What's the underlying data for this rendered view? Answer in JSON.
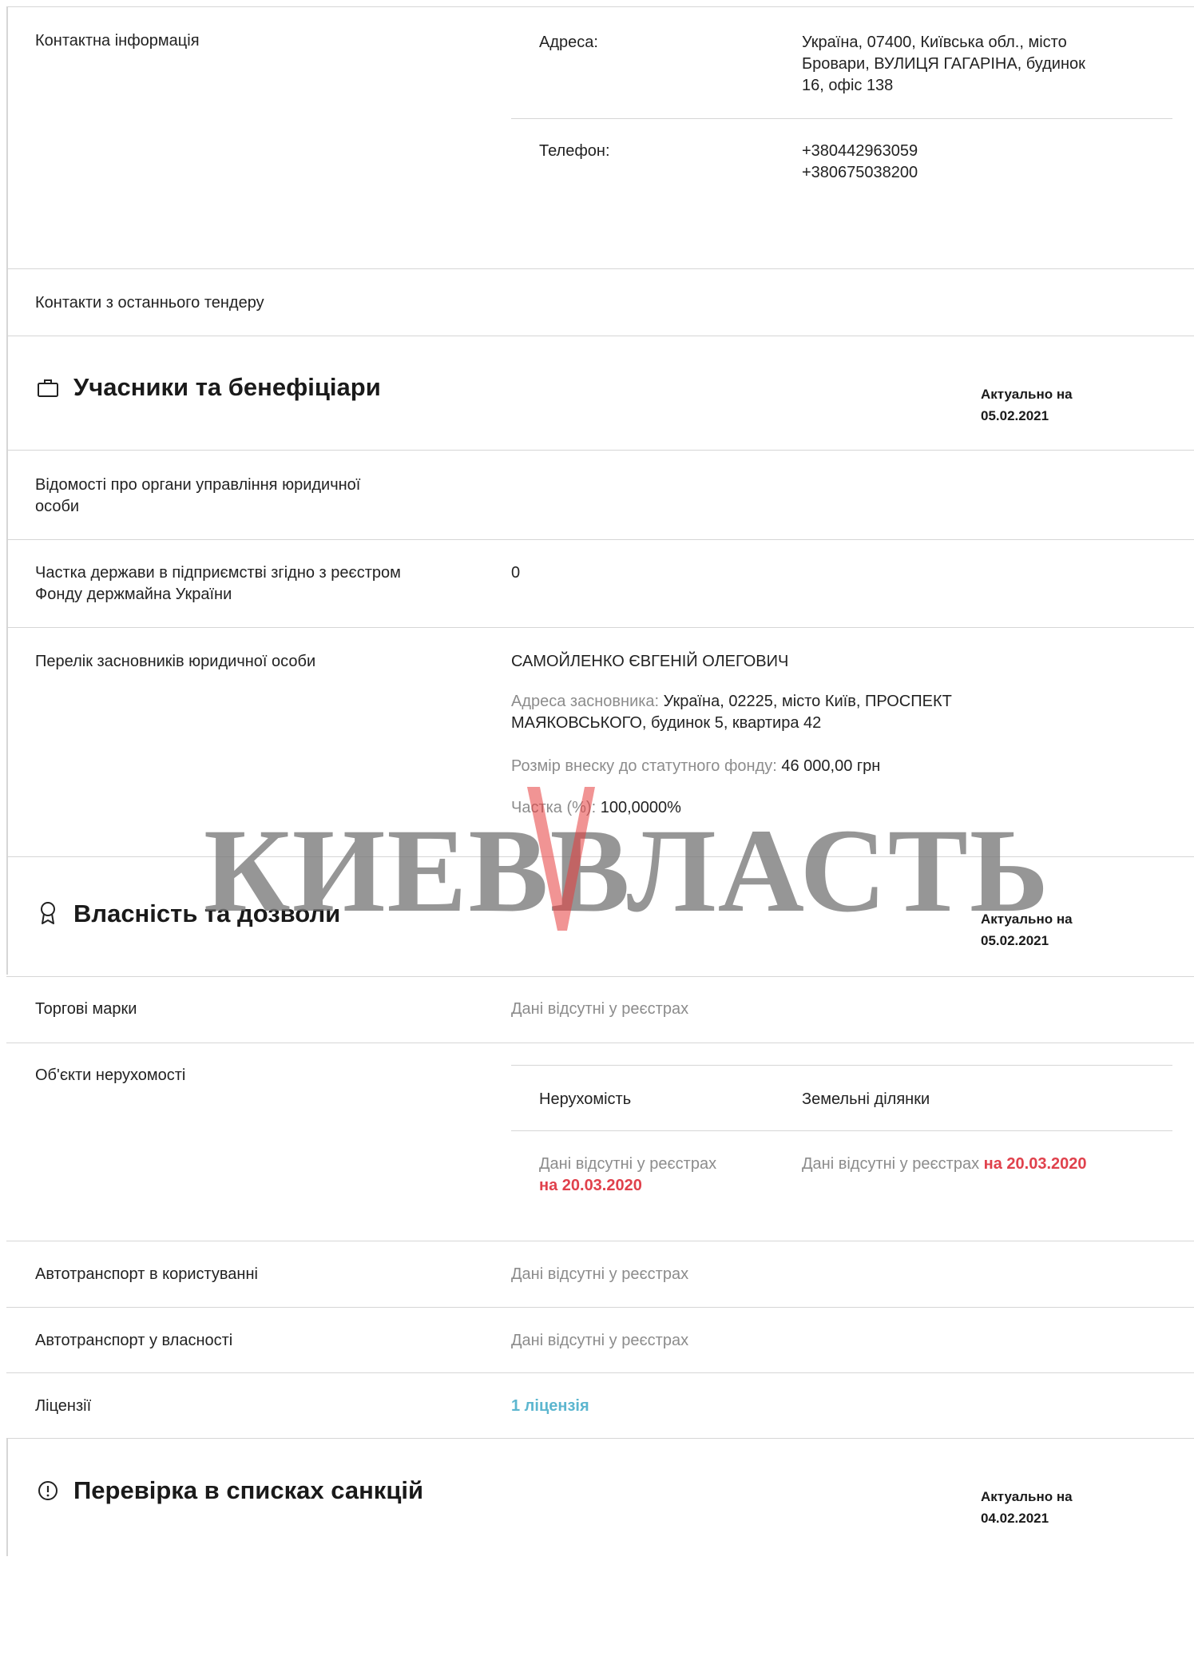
{
  "contacts": {
    "label": "Контактна інформація",
    "address_label": "Адреса:",
    "address_lines": [
      "Україна, 07400, Київська обл., місто",
      "Бровари, ВУЛИЦЯ ГАГАРІНА, будинок",
      "16, офіс 138"
    ],
    "phone_label": "Телефон:",
    "phones": [
      "+380442963059",
      "+380675038200"
    ],
    "last_tender_label": "Контакти з останнього тендеру"
  },
  "participants": {
    "title": "Учасники та бенефіціари",
    "asof_label": "Актуально на",
    "asof_date": "05.02.2021",
    "mgmt_label_lines": [
      "Відомості про органи управління юридичної",
      "особи"
    ],
    "state_share_label_lines": [
      "Частка держави в підприємстві згідно з реєстром",
      "Фонду держмайна України"
    ],
    "state_share_value": "0",
    "founders_label": "Перелік засновників юридичної особи",
    "founder_name": "САМОЙЛЕНКО ЄВГЕНІЙ ОЛЕГОВИЧ",
    "founder_address_label": "Адреса засновника:",
    "founder_address_lines": [
      "Україна, 02225, місто Київ, ПРОСПЕКТ",
      "МАЯКОВСЬКОГО, будинок 5, квартира 42"
    ],
    "contribution_label": "Розмір внеску до статутного фонду:",
    "contribution_value": "46 000,00 грн",
    "share_label": "Частка (%):",
    "share_value": "100,0000%"
  },
  "watermark": {
    "text": "КИЕВВЛАСТЬ"
  },
  "property": {
    "title": "Власність та дозволи",
    "asof_label": "Актуально на",
    "asof_date": "05.02.2021",
    "trademarks_label": "Торгові марки",
    "no_data": "Дані відсутні у реєстрах",
    "realty_label": "Об'єкти нерухомості",
    "realty_col1": "Нерухомість",
    "realty_col2": "Земельні ділянки",
    "realty_no_data_line1": "Дані відсутні у реєстрах",
    "realty_date": "на 20.03.2020",
    "land_no_data": "Дані відсутні у реєстрах",
    "land_date": "на 20.03.2020",
    "vehicles_use_label": "Автотранспорт в користуванні",
    "vehicles_own_label": "Автотранспорт у власності",
    "licenses_label": "Ліцензії",
    "licenses_value": "1 ліцензія"
  },
  "sanctions": {
    "title": "Перевірка в списках санкцій",
    "asof_label": "Актуально на",
    "asof_date": "04.02.2021"
  }
}
